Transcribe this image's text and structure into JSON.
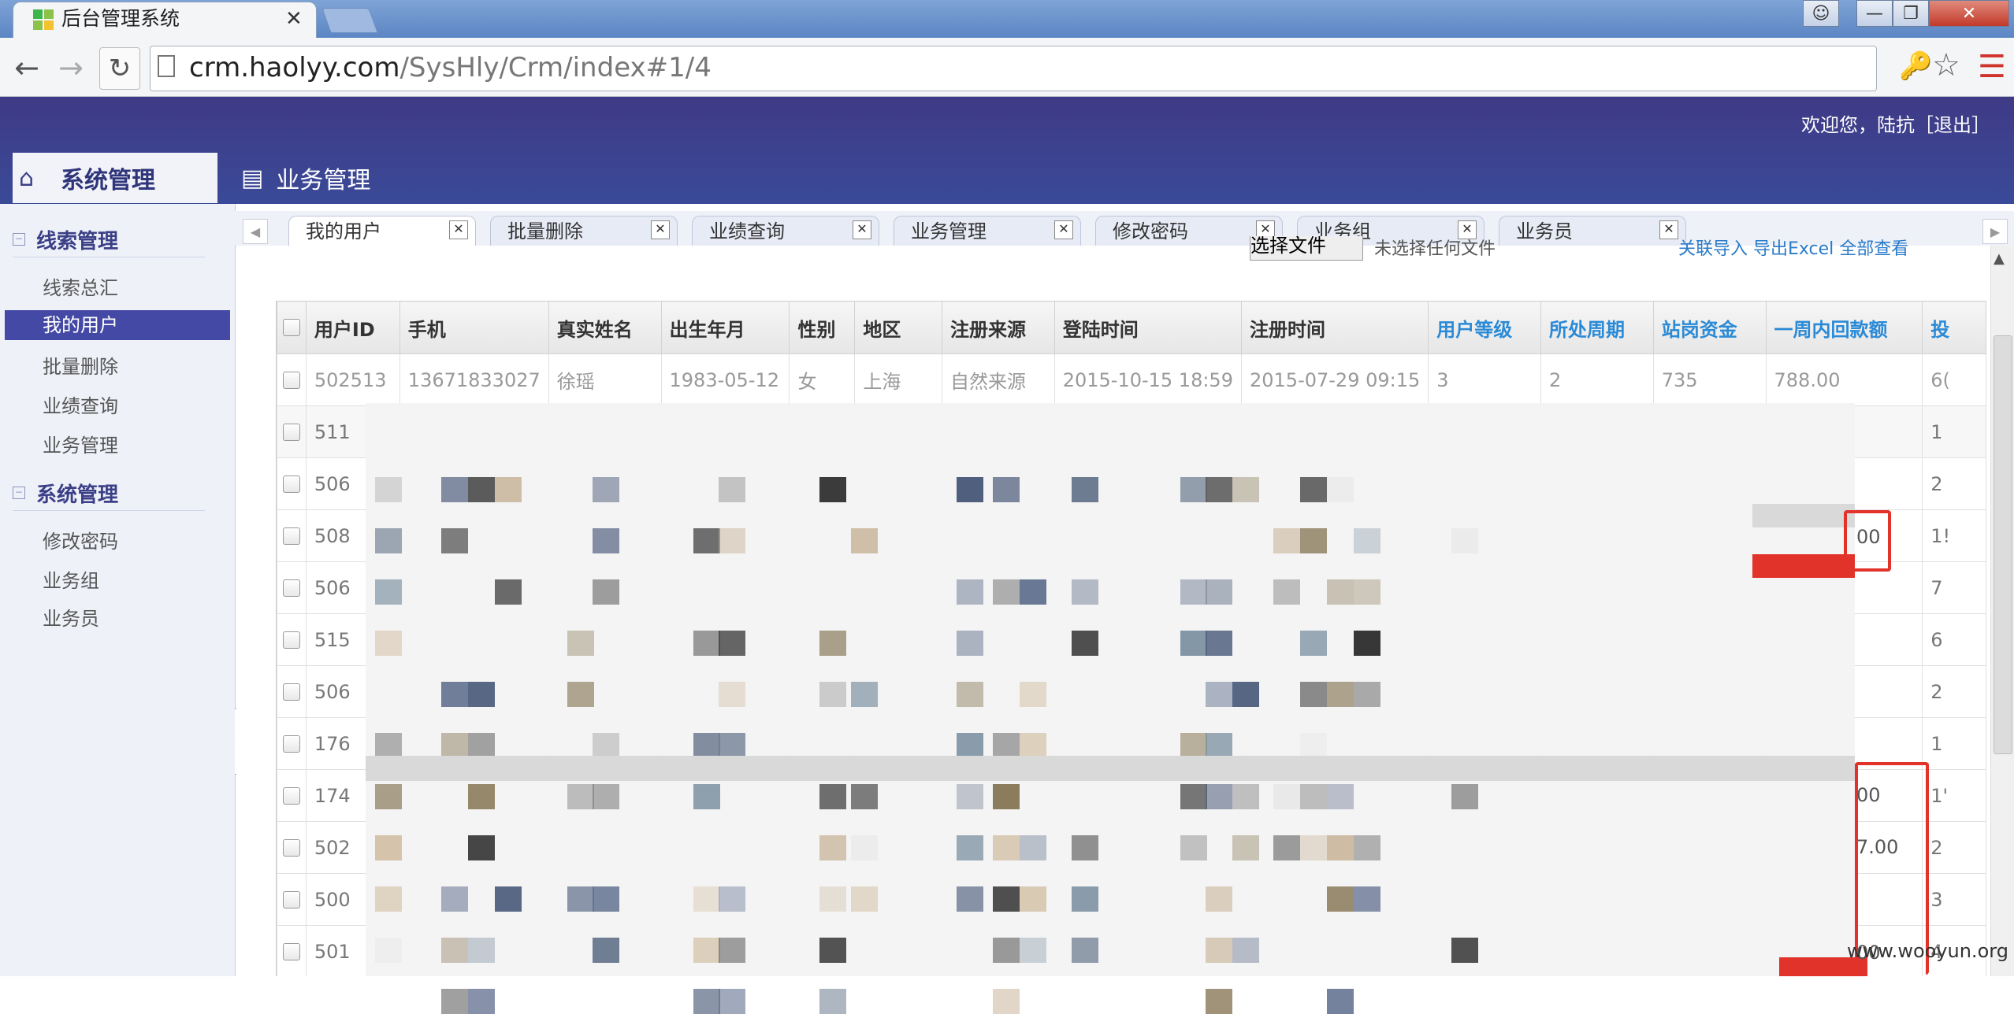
{
  "browser": {
    "tab_title": "后台管理系统",
    "tab_close": "✕",
    "url_host": "crm.haolyy.com",
    "url_path": "/SysHly/Crm/index#1/4"
  },
  "header": {
    "welcome": "欢迎您，陆抗［退出］",
    "nav_system": "系统管理",
    "nav_business": "业务管理"
  },
  "sidebar": {
    "group1": "线索管理",
    "group1_items": [
      "线索总汇",
      "我的用户",
      "批量删除",
      "业绩查询",
      "业务管理"
    ],
    "group2": "系统管理",
    "group2_items": [
      "修改密码",
      "业务组",
      "业务员"
    ]
  },
  "tabs": [
    "我的用户",
    "批量删除",
    "业绩查询",
    "业务管理",
    "修改密码",
    "业务组",
    "业务员"
  ],
  "toolbar": {
    "file_button": "选择文件",
    "file_status": "未选择任何文件",
    "links": "关联导入  导出Excel  全部查看"
  },
  "table": {
    "headers": [
      "用户ID",
      "手机",
      "真实姓名",
      "出生年月",
      "性别",
      "地区",
      "注册来源",
      "登陆时间",
      "注册时间",
      "用户等级",
      "所处周期",
      "站岗资金",
      "一周内回款额",
      "投"
    ],
    "first_row": [
      "502513",
      "13671833027",
      "徐瑶",
      "1983-05-12",
      "女",
      "上海",
      "自然来源",
      "2015-10-15 18:59",
      "2015-07-29 09:15",
      "3",
      "2",
      "735",
      "788.00",
      "6("
    ],
    "row_ids": [
      "511",
      "506",
      "508",
      "506",
      "515",
      "506",
      "176",
      "174",
      "502",
      "500",
      "501"
    ],
    "last_col": [
      "1",
      "2",
      "1!",
      "7",
      "6",
      "2",
      "1",
      "1'",
      "2",
      "3",
      "4"
    ],
    "visible_amounts": {
      "row3": "00",
      "row8": "00",
      "row9": "7.00",
      "row11": "00"
    }
  },
  "watermark": "www.wooyun.org",
  "colors": {
    "header": "#3f3a86",
    "accent_blue": "#2b8ad6",
    "highlight_red": "#e2332b",
    "sidebar_selected": "#4449a5"
  }
}
